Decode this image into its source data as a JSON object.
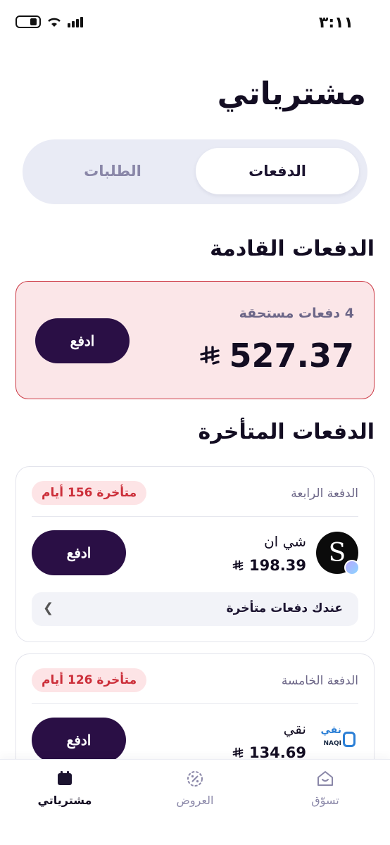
{
  "status_bar": {
    "time": "٣:١١"
  },
  "header": {
    "title": "مشترياتي"
  },
  "tabs": [
    {
      "label": "الدفعات",
      "active": true
    },
    {
      "label": "الطلبات",
      "active": false
    }
  ],
  "upcoming": {
    "section_title": "الدفعات القادمة",
    "count_text": "4 دفعات مستحقة",
    "amount": "527.37",
    "pay_label": "ادفع"
  },
  "late": {
    "section_title": "الدفعات المتأخرة",
    "cards": [
      {
        "installment": "الدفعة الرابعة",
        "badge": "متأخرة 156 أيام",
        "merchant": "شي ان",
        "logo_letter": "S",
        "amount": "198.39",
        "pay_label": "ادفع",
        "late_row_text": "عندك دفعات متأخرة"
      },
      {
        "installment": "الدفعة الخامسة",
        "badge": "متأخرة 126 أيام",
        "merchant": "نقي",
        "logo_text_ar": "نقي",
        "logo_text_en": "NAQI",
        "amount": "134.69",
        "pay_label": "ادفع"
      }
    ]
  },
  "bottom_nav": [
    {
      "label": "مشترياتي",
      "icon": "purchases-icon",
      "active": true
    },
    {
      "label": "العروض",
      "icon": "discount-icon",
      "active": false
    },
    {
      "label": "تسوّق",
      "icon": "shop-icon",
      "active": false
    }
  ],
  "colors": {
    "primary": "#2a0f45",
    "late_red": "#cc2f3a",
    "upcoming_bg": "#fbe6e8"
  }
}
